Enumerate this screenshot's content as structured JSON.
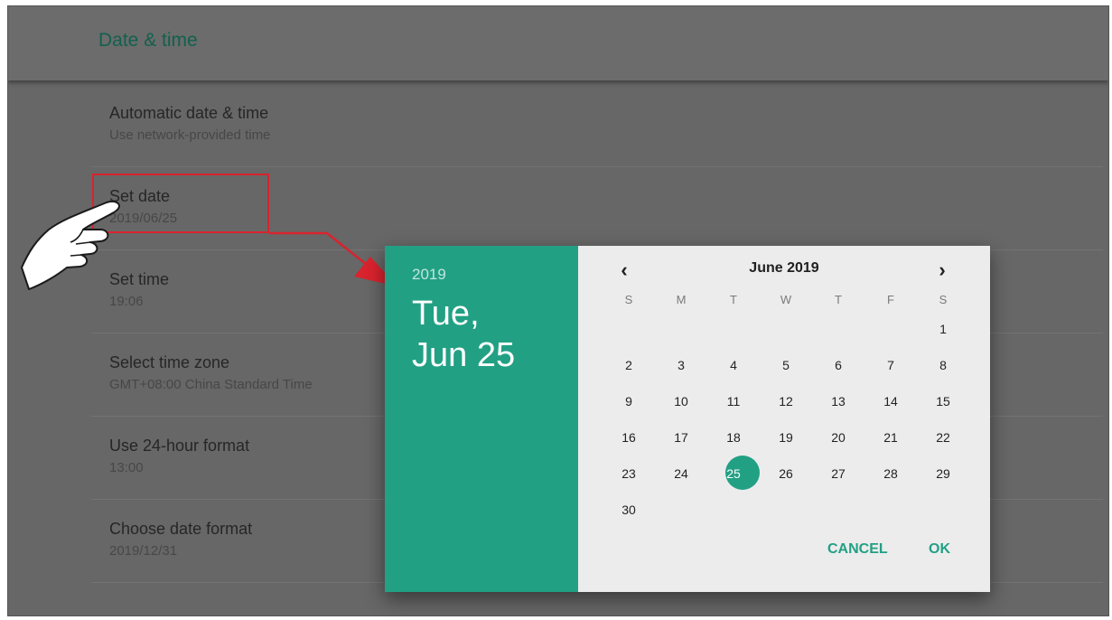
{
  "appbar": {
    "title": "Date & time"
  },
  "settings": [
    {
      "title": "Automatic date & time",
      "subtitle": "Use network-provided time"
    },
    {
      "title": "Set date",
      "subtitle": "2019/06/25"
    },
    {
      "title": "Set time",
      "subtitle": "19:06"
    },
    {
      "title": "Select time zone",
      "subtitle": "GMT+08:00 China Standard Time"
    },
    {
      "title": "Use 24-hour format",
      "subtitle": "13:00"
    },
    {
      "title": "Choose date format",
      "subtitle": "2019/12/31"
    }
  ],
  "dialog": {
    "year": "2019",
    "date_line1": "Tue,",
    "date_line2": "Jun 25",
    "month_label": "June 2019",
    "prev_icon": "chevron-left-icon",
    "next_icon": "chevron-right-icon",
    "weekdays": [
      "S",
      "M",
      "T",
      "W",
      "T",
      "F",
      "S"
    ],
    "weeks": [
      [
        "",
        "",
        "",
        "",
        "",
        "",
        "1"
      ],
      [
        "2",
        "3",
        "4",
        "5",
        "6",
        "7",
        "8"
      ],
      [
        "9",
        "10",
        "11",
        "12",
        "13",
        "14",
        "15"
      ],
      [
        "16",
        "17",
        "18",
        "19",
        "20",
        "21",
        "22"
      ],
      [
        "23",
        "24",
        "25",
        "26",
        "27",
        "28",
        "29"
      ],
      [
        "30",
        "",
        "",
        "",
        "",
        "",
        ""
      ]
    ],
    "selected_day": "25",
    "cancel_label": "CANCEL",
    "ok_label": "OK"
  },
  "colors": {
    "accent": "#22a084",
    "highlight_box": "#d9232e",
    "overlay_bg": "#666766"
  }
}
